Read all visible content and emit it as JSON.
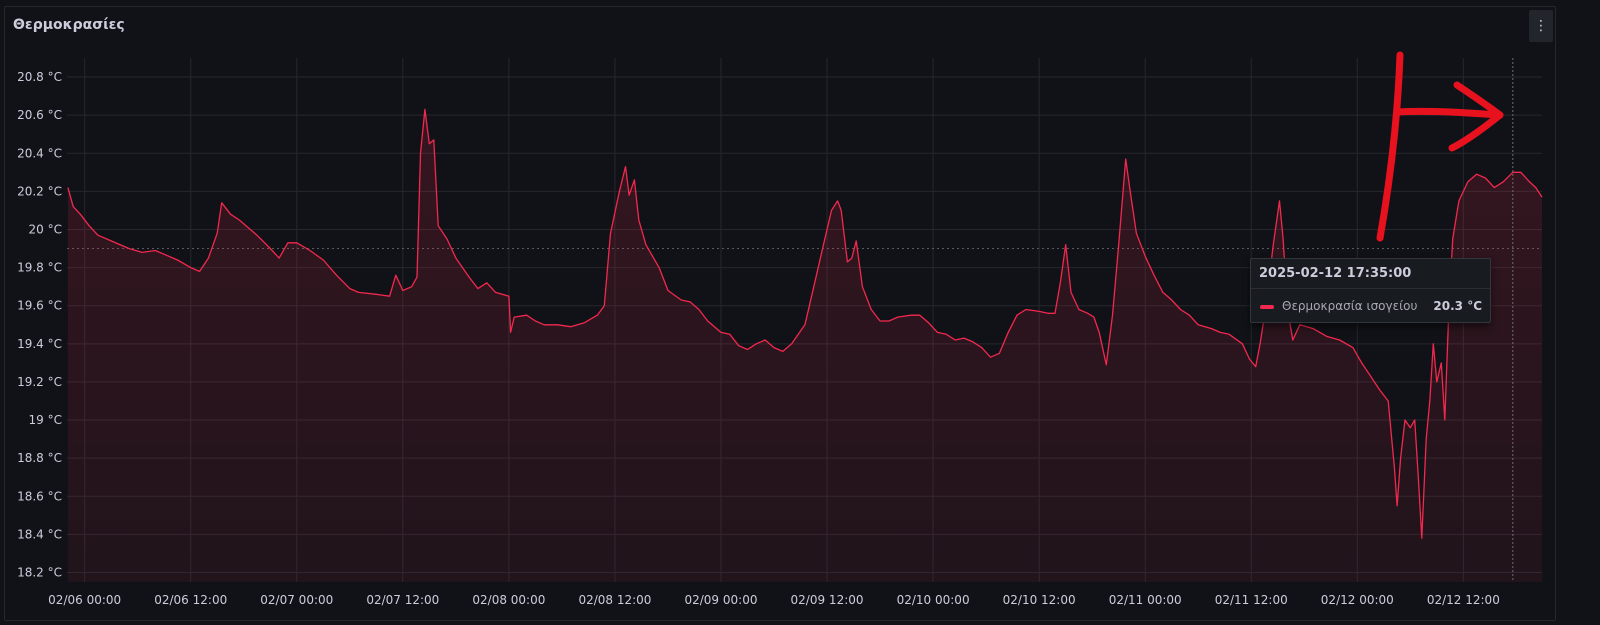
{
  "panel": {
    "title": "Θερμοκρασίες",
    "menu_icon": "kebab-menu-icon"
  },
  "colors": {
    "series": "#f2284e",
    "annotation": "#e8121f",
    "background": "#111217",
    "grid": "#2a2b31"
  },
  "tooltip": {
    "time": "2025-02-12 17:35:00",
    "series_name": "Θερμοκρασία ισογείου",
    "value": "20.3 °C"
  },
  "chart_data": {
    "type": "line",
    "title": "Θερμοκρασίες",
    "unit": "°C",
    "ylim": [
      18.15,
      20.9
    ],
    "y_ticks": [
      {
        "value": 20.8,
        "label": "20.8 °C"
      },
      {
        "value": 20.6,
        "label": "20.6 °C"
      },
      {
        "value": 20.4,
        "label": "20.4 °C"
      },
      {
        "value": 20.2,
        "label": "20.2 °C"
      },
      {
        "value": 20.0,
        "label": "20 °C"
      },
      {
        "value": 19.8,
        "label": "19.8 °C"
      },
      {
        "value": 19.6,
        "label": "19.6 °C"
      },
      {
        "value": 19.4,
        "label": "19.4 °C"
      },
      {
        "value": 19.2,
        "label": "19.2 °C"
      },
      {
        "value": 19.0,
        "label": "19 °C"
      },
      {
        "value": 18.8,
        "label": "18.8 °C"
      },
      {
        "value": 18.6,
        "label": "18.6 °C"
      },
      {
        "value": 18.4,
        "label": "18.4 °C"
      },
      {
        "value": 18.2,
        "label": "18.2 °C"
      }
    ],
    "x_ticks": [
      "02/06 00:00",
      "02/06 12:00",
      "02/07 00:00",
      "02/07 12:00",
      "02/08 00:00",
      "02/08 12:00",
      "02/09 00:00",
      "02/09 12:00",
      "02/10 00:00",
      "02/10 12:00",
      "02/11 00:00",
      "02/11 12:00",
      "02/12 00:00",
      "02/12 12:00"
    ],
    "x_tick_hours": [
      0,
      12,
      24,
      36,
      48,
      60,
      72,
      84,
      96,
      108,
      120,
      132,
      144,
      156
    ],
    "x_range_hours": [
      -2,
      164.9
    ],
    "threshold": 19.9,
    "hover_hour": 161.6,
    "grid": true,
    "legend": "none",
    "series": [
      {
        "name": "Θερμοκρασία ισογείου",
        "points": [
          [
            -1.9,
            20.22
          ],
          [
            -1.3,
            20.12
          ],
          [
            -0.5,
            20.08
          ],
          [
            0.5,
            20.02
          ],
          [
            1.5,
            19.97
          ],
          [
            3,
            19.94
          ],
          [
            5,
            19.9
          ],
          [
            6.5,
            19.88
          ],
          [
            8,
            19.89
          ],
          [
            9,
            19.87
          ],
          [
            10.5,
            19.84
          ],
          [
            12,
            19.8
          ],
          [
            13,
            19.78
          ],
          [
            14,
            19.85
          ],
          [
            15,
            19.98
          ],
          [
            15.5,
            20.14
          ],
          [
            16.5,
            20.08
          ],
          [
            17.5,
            20.05
          ],
          [
            19.5,
            19.97
          ],
          [
            21,
            19.9
          ],
          [
            22,
            19.85
          ],
          [
            23,
            19.93
          ],
          [
            24,
            19.93
          ],
          [
            25.5,
            19.89
          ],
          [
            27,
            19.84
          ],
          [
            28.5,
            19.76
          ],
          [
            30,
            19.69
          ],
          [
            31,
            19.67
          ],
          [
            33,
            19.66
          ],
          [
            34.5,
            19.65
          ],
          [
            35.2,
            19.76
          ],
          [
            36,
            19.68
          ],
          [
            37,
            19.7
          ],
          [
            37.6,
            19.75
          ],
          [
            38,
            20.4
          ],
          [
            38.5,
            20.63
          ],
          [
            39,
            20.45
          ],
          [
            39.5,
            20.47
          ],
          [
            40,
            20.02
          ],
          [
            41,
            19.95
          ],
          [
            42,
            19.85
          ],
          [
            43.5,
            19.75
          ],
          [
            44.5,
            19.69
          ],
          [
            45.5,
            19.72
          ],
          [
            46.5,
            19.67
          ],
          [
            48,
            19.65
          ],
          [
            48.2,
            19.46
          ],
          [
            48.6,
            19.54
          ],
          [
            50,
            19.55
          ],
          [
            51,
            19.52
          ],
          [
            52,
            19.5
          ],
          [
            53.5,
            19.5
          ],
          [
            55,
            19.49
          ],
          [
            56.5,
            19.51
          ],
          [
            58,
            19.55
          ],
          [
            58.8,
            19.6
          ],
          [
            59.5,
            19.98
          ],
          [
            60.5,
            20.2
          ],
          [
            61.2,
            20.33
          ],
          [
            61.6,
            20.18
          ],
          [
            62.2,
            20.26
          ],
          [
            62.7,
            20.05
          ],
          [
            63.5,
            19.92
          ],
          [
            64.5,
            19.84
          ],
          [
            65,
            19.8
          ],
          [
            66,
            19.68
          ],
          [
            67.5,
            19.63
          ],
          [
            68.5,
            19.62
          ],
          [
            69.5,
            19.58
          ],
          [
            70.5,
            19.52
          ],
          [
            72,
            19.46
          ],
          [
            73,
            19.45
          ],
          [
            74,
            19.39
          ],
          [
            75,
            19.37
          ],
          [
            76,
            19.4
          ],
          [
            77,
            19.42
          ],
          [
            78,
            19.38
          ],
          [
            79,
            19.36
          ],
          [
            80,
            19.4
          ],
          [
            81.5,
            19.5
          ],
          [
            82,
            19.6
          ],
          [
            83.5,
            19.9
          ],
          [
            84.5,
            20.1
          ],
          [
            85.2,
            20.15
          ],
          [
            85.6,
            20.1
          ],
          [
            86.3,
            19.83
          ],
          [
            86.8,
            19.85
          ],
          [
            87.3,
            19.94
          ],
          [
            88,
            19.7
          ],
          [
            89,
            19.58
          ],
          [
            90,
            19.52
          ],
          [
            91,
            19.52
          ],
          [
            92,
            19.54
          ],
          [
            93.5,
            19.55
          ],
          [
            94.5,
            19.55
          ],
          [
            95.5,
            19.51
          ],
          [
            96.5,
            19.46
          ],
          [
            97.5,
            19.45
          ],
          [
            98.5,
            19.42
          ],
          [
            99.5,
            19.43
          ],
          [
            100.5,
            19.41
          ],
          [
            101.5,
            19.38
          ],
          [
            102.5,
            19.33
          ],
          [
            103.5,
            19.35
          ],
          [
            104.5,
            19.46
          ],
          [
            105.5,
            19.55
          ],
          [
            106.5,
            19.58
          ],
          [
            108,
            19.57
          ],
          [
            109,
            19.56
          ],
          [
            109.8,
            19.56
          ],
          [
            110.4,
            19.72
          ],
          [
            111,
            19.92
          ],
          [
            111.6,
            19.67
          ],
          [
            112.5,
            19.58
          ],
          [
            113.5,
            19.56
          ],
          [
            114.2,
            19.54
          ],
          [
            114.8,
            19.46
          ],
          [
            115.6,
            19.29
          ],
          [
            116.3,
            19.55
          ],
          [
            117,
            19.92
          ],
          [
            117.8,
            20.37
          ],
          [
            118.3,
            20.2
          ],
          [
            119,
            19.98
          ],
          [
            120,
            19.86
          ],
          [
            121,
            19.76
          ],
          [
            122,
            19.67
          ],
          [
            123,
            19.63
          ],
          [
            124,
            19.58
          ],
          [
            125,
            19.55
          ],
          [
            126,
            19.5
          ],
          [
            127.5,
            19.48
          ],
          [
            128.5,
            19.46
          ],
          [
            129.5,
            19.45
          ],
          [
            131,
            19.4
          ],
          [
            131.8,
            19.32
          ],
          [
            132.5,
            19.28
          ],
          [
            133,
            19.4
          ],
          [
            133.6,
            19.58
          ],
          [
            134.5,
            19.92
          ],
          [
            135.2,
            20.15
          ],
          [
            135.6,
            19.95
          ],
          [
            136.1,
            19.58
          ],
          [
            136.7,
            19.42
          ],
          [
            137.5,
            19.5
          ],
          [
            139,
            19.48
          ],
          [
            140.5,
            19.44
          ],
          [
            142,
            19.42
          ],
          [
            143.5,
            19.38
          ],
          [
            144.5,
            19.3
          ],
          [
            145.5,
            19.23
          ],
          [
            146.5,
            19.16
          ],
          [
            147.5,
            19.1
          ],
          [
            148.2,
            18.75
          ],
          [
            148.5,
            18.55
          ],
          [
            148.9,
            18.8
          ],
          [
            149.4,
            19.0
          ],
          [
            150,
            18.96
          ],
          [
            150.5,
            19.0
          ],
          [
            150.9,
            18.7
          ],
          [
            151.3,
            18.38
          ],
          [
            151.8,
            18.9
          ],
          [
            152.2,
            19.1
          ],
          [
            152.6,
            19.4
          ],
          [
            153,
            19.2
          ],
          [
            153.5,
            19.3
          ],
          [
            153.9,
            19.0
          ],
          [
            154.3,
            19.5
          ],
          [
            154.8,
            19.95
          ],
          [
            155.5,
            20.15
          ],
          [
            156.5,
            20.25
          ],
          [
            157.5,
            20.29
          ],
          [
            158.5,
            20.27
          ],
          [
            159.5,
            20.22
          ],
          [
            160.5,
            20.25
          ],
          [
            161.6,
            20.3
          ],
          [
            162.5,
            20.3
          ],
          [
            163.5,
            20.25
          ],
          [
            164.2,
            20.22
          ],
          [
            164.9,
            20.17
          ]
        ]
      }
    ]
  },
  "annotation": {
    "icon": "hand-drawn-red-arrow-icon"
  }
}
